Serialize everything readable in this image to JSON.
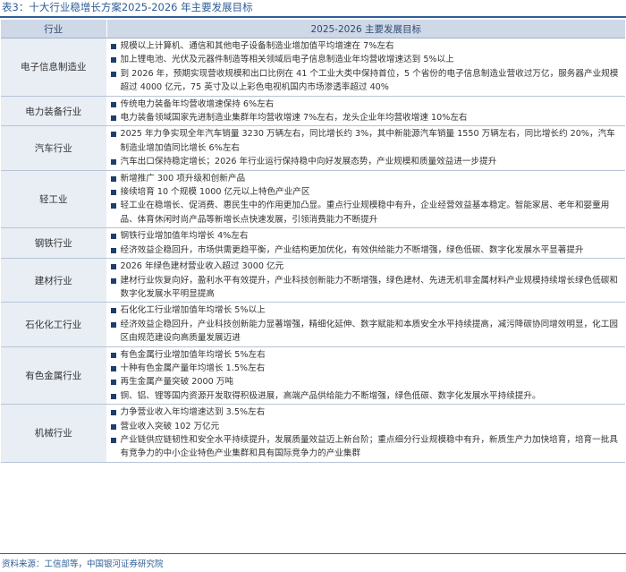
{
  "title": "表3：十大行业稳增长方案2025-2026 年主要发展目标",
  "table": {
    "headers": [
      "行业",
      "2025-2026 主要发展目标"
    ],
    "rows": [
      {
        "sector": "电子信息制造业",
        "goals": [
          "规模以上计算机、通信和其他电子设备制造业增加值平均增速在 7%左右",
          "加上锂电池、光伏及元器件制造等相关领域后电子信息制造业年均营收增速达到 5%以上",
          "到 2026 年，预期实现营收规模和出口比例在 41 个工业大类中保持首位，5 个省份的电子信息制造业营收过万亿，服务器产业规模超过 4000 亿元，75 英寸及以上彩色电视机国内市场渗透率超过 40%"
        ]
      },
      {
        "sector": "电力装备行业",
        "goals": [
          "传统电力装备年均营收增速保持 6%左右",
          "电力装备领域国家先进制造业集群年均营收增速 7%左右，龙头企业年均营收增速 10%左右"
        ]
      },
      {
        "sector": "汽车行业",
        "goals": [
          "2025 年力争实现全年汽车销量 3230 万辆左右，同比增长约 3%，其中新能源汽车销量 1550 万辆左右，同比增长约 20%，汽车制造业增加值同比增长 6%左右",
          "汽车出口保持稳定增长；2026 年行业运行保持稳中向好发展态势，产业规模和质量效益进一步提升"
        ]
      },
      {
        "sector": "轻工业",
        "goals": [
          "新增推广 300 项升级和创新产品",
          "接续培育 10 个规模 1000 亿元以上特色产业产区",
          "轻工业在稳增长、促消费、惠民生中的作用更加凸显。重点行业规模稳中有升，企业经营效益基本稳定。智能家居、老年和婴童用品、体育休闲时尚产品等新增长点快速发展，引领消费能力不断提升"
        ]
      },
      {
        "sector": "钢铁行业",
        "goals": [
          "钢铁行业增加值年均增长 4%左右",
          "经济效益企稳回升，市场供需更趋平衡，产业结构更加优化，有效供给能力不断增强，绿色低碳、数字化发展水平显著提升"
        ]
      },
      {
        "sector": "建材行业",
        "goals": [
          "2026 年绿色建材营业收入超过 3000 亿元",
          "建材行业恢复向好，盈利水平有效提升，产业科技创新能力不断增强，绿色建材、先进无机非金属材料产业规模持续增长绿色低碳和数字化发展水平明显提高"
        ]
      },
      {
        "sector": "石化化工行业",
        "goals": [
          "石化化工行业增加值年均增长 5%以上",
          "经济效益企稳回升，产业科技创新能力显著增强，精细化延伸、数字赋能和本质安全水平持续提高，减污降碳协同增效明显，化工园区由规范建设向高质量发展迈进"
        ]
      },
      {
        "sector": "有色金属行业",
        "goals": [
          "有色金属行业增加值年均增长 5%左右",
          "十种有色金属产量年均增长 1.5%左右",
          "再生金属产量突破 2000 万吨",
          "铜、铝、锂等国内资源开发取得积极进展，高端产品供给能力不断增强，绿色低碳、数字化发展水平持续提升。"
        ]
      },
      {
        "sector": "机械行业",
        "goals": [
          "力争营业收入年均增速达到 3.5%左右",
          "营业收入突破 102 万亿元",
          "产业链供应链韧性和安全水平持续提升，发展质量效益迈上新台阶；重点细分行业规模稳中有升，新质生产力加快培育，培育一批具有竞争力的中小企业特色产业集群和具有国际竞争力的产业集群"
        ]
      }
    ]
  },
  "source": "资料来源：工信部等，中国银河证券研究院"
}
